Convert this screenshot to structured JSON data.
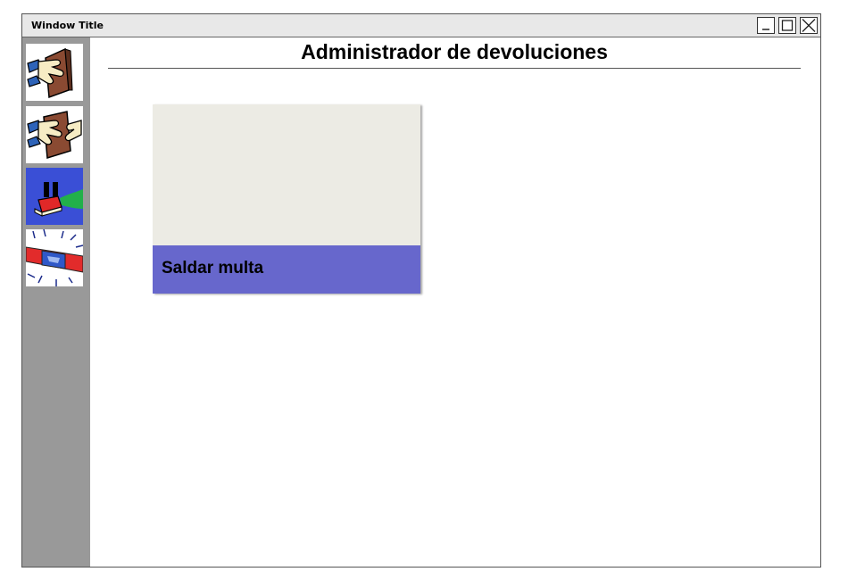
{
  "window": {
    "title": "Window Title",
    "controls": [
      "minimize-icon",
      "maximize-icon",
      "close-icon"
    ]
  },
  "sidebar": {
    "items": [
      {
        "icon": "hand-giving-book-icon"
      },
      {
        "icon": "hands-exchanging-book-icon"
      },
      {
        "icon": "paused-book-icon"
      },
      {
        "icon": "alarm-siren-icon"
      }
    ]
  },
  "main": {
    "title": "Administrador de devoluciones",
    "card": {
      "label": "Saldar multa"
    }
  },
  "colors": {
    "sidebar": "#999999",
    "card_body": "#ecebe4",
    "card_footer": "#6767cc",
    "paused_item_bg": "#3a4fd6"
  }
}
